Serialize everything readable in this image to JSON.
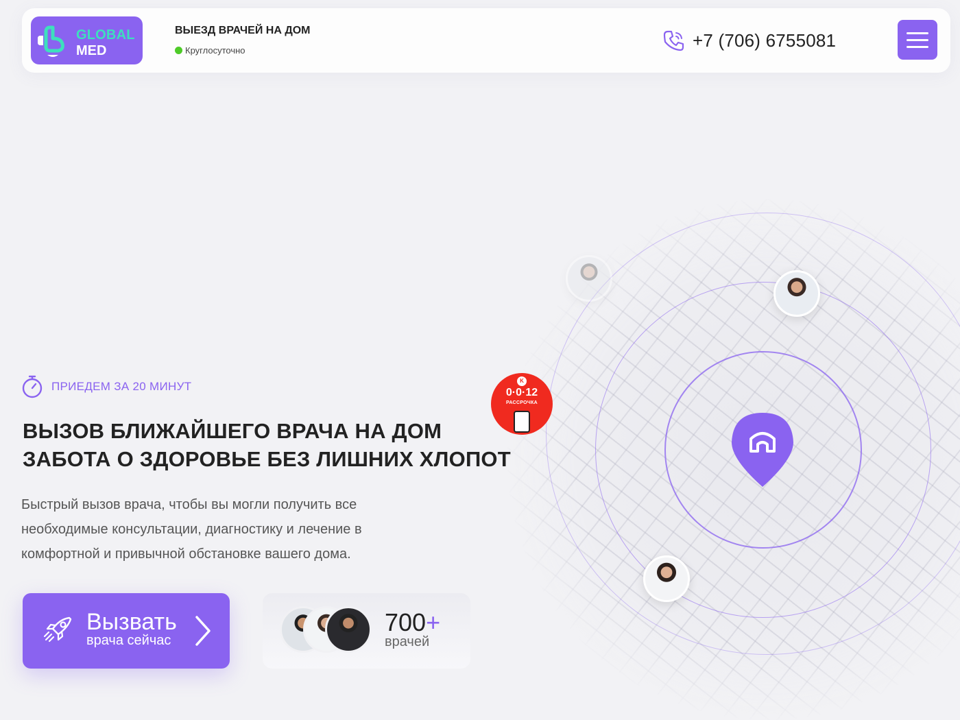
{
  "header": {
    "logo_line1": "GLOBAL",
    "logo_line2": "MED",
    "title": "ВЫЕЗД ВРАЧЕЙ НА ДОМ",
    "status": "Круглосуточно",
    "phone": "+7 (706) 6755081",
    "phone_icon": "phone-icon",
    "menu_icon": "hamburger-menu-icon"
  },
  "hero": {
    "badge": "ПРИЕДЕМ ЗА 20 МИНУТ",
    "badge_icon": "stopwatch-icon",
    "title_line1": "ВЫЗОВ БЛИЖАЙШЕГО ВРАЧА НА ДОМ",
    "title_line2": "ЗАБОТА О ЗДОРОВЬЕ БЕЗ ЛИШНИХ ХЛОПОТ",
    "description_line1": "Быстрый вызов врача, чтобы вы могли получить все",
    "description_line2": "необходимые консультации, диагностику и лечение в",
    "description_line3": "комфортной и привычной обстановке вашего дома."
  },
  "cta": {
    "main": "Вызвать",
    "sub": "врача сейчас",
    "icon": "rocket-icon"
  },
  "doctors": {
    "count": "700",
    "plus": "+",
    "label": "врачей"
  },
  "promo": {
    "main": "0·0·12",
    "sub": "РАССРОЧКА"
  },
  "colors": {
    "accent": "#8a63f0",
    "logo_green": "#3de0bd",
    "status_green": "#4ecb28",
    "promo_red": "#f02a1f"
  }
}
